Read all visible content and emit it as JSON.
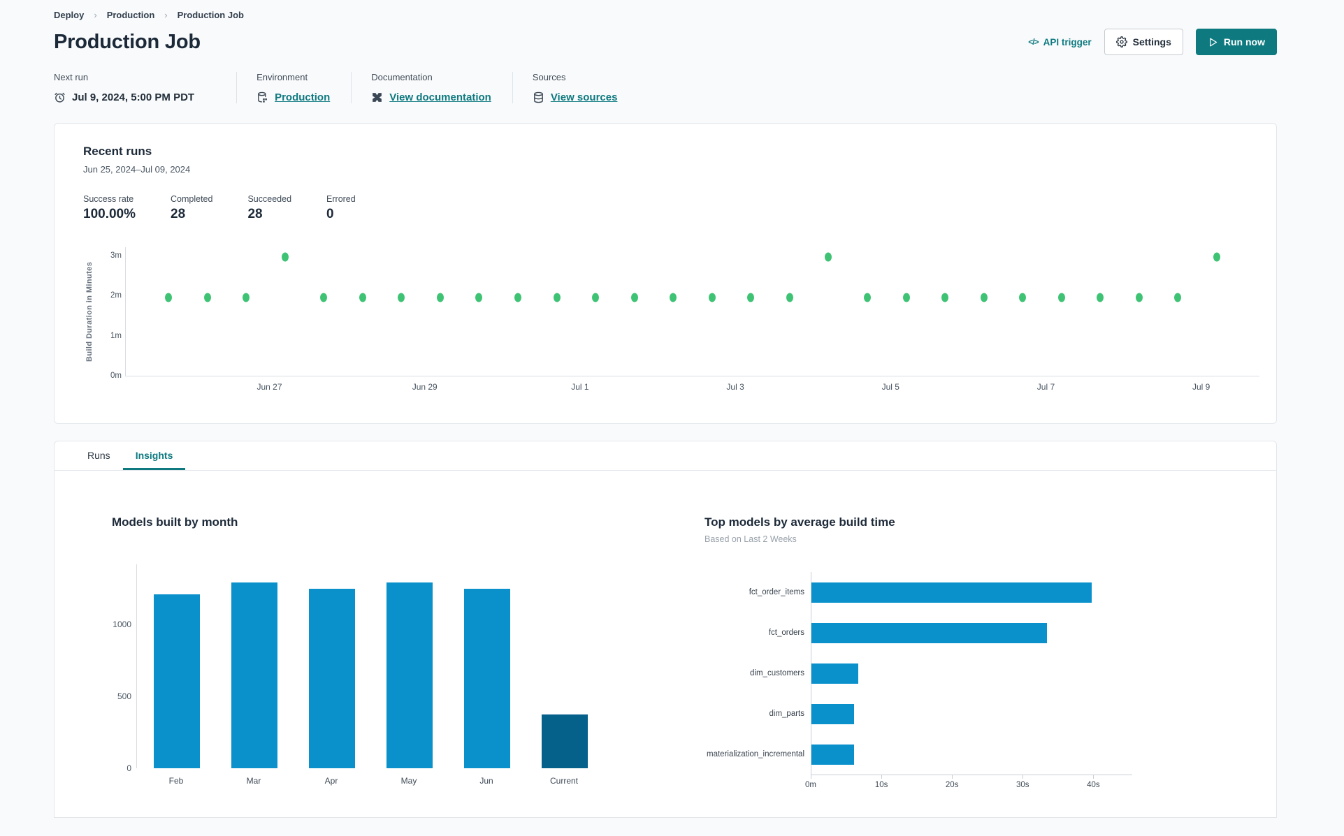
{
  "breadcrumb": {
    "items": [
      "Deploy",
      "Production",
      "Production Job"
    ],
    "separator": "›"
  },
  "header": {
    "title": "Production Job",
    "api_trigger": {
      "glyph": "</>",
      "label": "API trigger"
    },
    "settings_button": "Settings",
    "run_now_button": "Run now"
  },
  "meta": {
    "next_run": {
      "label": "Next run",
      "value": "Jul 9, 2024, 5:00 PM PDT",
      "icon": "alarm-clock"
    },
    "environment": {
      "label": "Environment",
      "value": "Production",
      "icon": "environment-database"
    },
    "documentation": {
      "label": "Documentation",
      "value": "View documentation",
      "icon": "dbt-logo"
    },
    "sources": {
      "label": "Sources",
      "value": "View sources",
      "icon": "database"
    }
  },
  "recent_runs": {
    "title": "Recent runs",
    "date_range": "Jun 25, 2024–Jul 09, 2024",
    "stats": [
      {
        "label": "Success rate",
        "value": "100.00%"
      },
      {
        "label": "Completed",
        "value": "28"
      },
      {
        "label": "Succeeded",
        "value": "28"
      },
      {
        "label": "Errored",
        "value": "0"
      }
    ]
  },
  "tabs": [
    {
      "label": "Runs",
      "active": false
    },
    {
      "label": "Insights",
      "active": true
    }
  ],
  "colors": {
    "accent_teal": "#0E7A80",
    "chart_blue": "#0A91CC",
    "chart_blue_dark": "#05608A",
    "dot_green": "#3EC273",
    "axis_gray": "#D8DDE3"
  },
  "chart_data": [
    {
      "type": "scatter",
      "name": "build-duration-by-run",
      "ylabel": "Build Duration in Minutes",
      "x_axis": {
        "unit": "days since Jun 25, 2024",
        "min": 0.15,
        "max": 14.75,
        "tick_values": [
          2,
          4,
          6,
          8,
          10,
          12,
          14
        ],
        "tick_labels": [
          "Jun 27",
          "Jun 29",
          "Jul 1",
          "Jul 3",
          "Jul 5",
          "Jul 7",
          "Jul 9"
        ]
      },
      "y_axis": {
        "unit": "minutes",
        "min": 0,
        "max": 3.2,
        "tick_values": [
          0,
          1,
          2,
          3
        ],
        "tick_labels": [
          "0m",
          "1m",
          "2m",
          "3m"
        ]
      },
      "series": [
        {
          "name": "runs",
          "color": "#3EC273",
          "points": [
            {
              "x": 0.7,
              "y": 1.95
            },
            {
              "x": 1.2,
              "y": 1.95
            },
            {
              "x": 1.7,
              "y": 1.95
            },
            {
              "x": 2.2,
              "y": 2.95
            },
            {
              "x": 2.7,
              "y": 1.95
            },
            {
              "x": 3.2,
              "y": 1.95
            },
            {
              "x": 3.7,
              "y": 1.95
            },
            {
              "x": 4.2,
              "y": 1.95
            },
            {
              "x": 4.7,
              "y": 1.95
            },
            {
              "x": 5.2,
              "y": 1.95
            },
            {
              "x": 5.7,
              "y": 1.95
            },
            {
              "x": 6.2,
              "y": 1.95
            },
            {
              "x": 6.7,
              "y": 1.95
            },
            {
              "x": 7.2,
              "y": 1.95
            },
            {
              "x": 7.7,
              "y": 1.95
            },
            {
              "x": 8.2,
              "y": 1.95
            },
            {
              "x": 8.7,
              "y": 1.95
            },
            {
              "x": 9.2,
              "y": 2.95
            },
            {
              "x": 9.7,
              "y": 1.95
            },
            {
              "x": 10.2,
              "y": 1.95
            },
            {
              "x": 10.7,
              "y": 1.95
            },
            {
              "x": 11.2,
              "y": 1.95
            },
            {
              "x": 11.7,
              "y": 1.95
            },
            {
              "x": 12.2,
              "y": 1.95
            },
            {
              "x": 12.7,
              "y": 1.95
            },
            {
              "x": 13.2,
              "y": 1.95
            },
            {
              "x": 13.7,
              "y": 1.95
            },
            {
              "x": 14.2,
              "y": 2.95
            }
          ]
        }
      ]
    },
    {
      "type": "bar",
      "name": "models-built-by-month",
      "title": "Models built by month",
      "categories": [
        "Feb",
        "Mar",
        "Apr",
        "May",
        "Jun",
        "Current"
      ],
      "values": [
        1210,
        1295,
        1250,
        1295,
        1250,
        375
      ],
      "bar_colors": [
        "#0A91CC",
        "#0A91CC",
        "#0A91CC",
        "#0A91CC",
        "#0A91CC",
        "#05608A"
      ],
      "ylim": [
        0,
        1420
      ],
      "y_ticks": [
        0,
        500,
        1000
      ]
    },
    {
      "type": "bar-horizontal",
      "name": "top-models-by-average-build-time",
      "title": "Top models by average build time",
      "subtitle": "Based on Last 2 Weeks",
      "categories": [
        "fct_order_items",
        "fct_orders",
        "dim_customers",
        "dim_parts",
        "materialization_incremental"
      ],
      "values_seconds": [
        39.8,
        33.4,
        6.6,
        6.0,
        6.0
      ],
      "xlim_seconds": [
        0,
        45.5
      ],
      "x_ticks": [
        {
          "value": 0,
          "label": "0m"
        },
        {
          "value": 10,
          "label": "10s"
        },
        {
          "value": 20,
          "label": "20s"
        },
        {
          "value": 30,
          "label": "30s"
        },
        {
          "value": 40,
          "label": "40s"
        }
      ],
      "bar_color": "#0A91CC"
    }
  ]
}
